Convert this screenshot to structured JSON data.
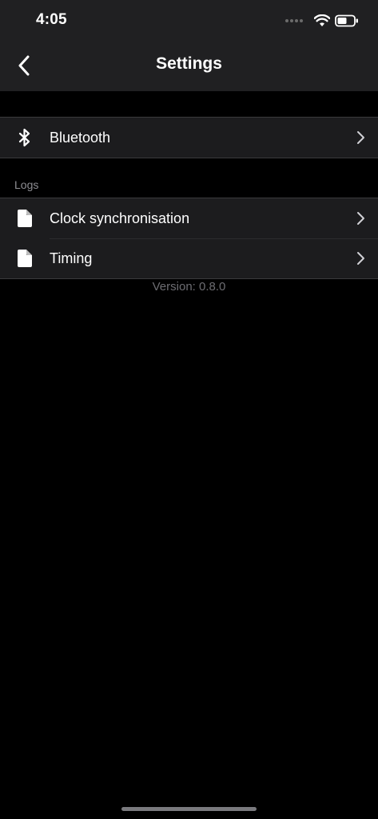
{
  "status_bar": {
    "time": "4:05",
    "icons": [
      "signal-icon",
      "wifi-icon",
      "battery-icon"
    ]
  },
  "nav": {
    "back_icon": "chevron-left-icon",
    "title": "Settings"
  },
  "groups": [
    {
      "header": "",
      "items": [
        {
          "label": "Bluetooth",
          "icon": "bluetooth-icon"
        }
      ]
    },
    {
      "header": "Logs",
      "items": [
        {
          "label": "Clock synchronisation",
          "icon": "document-icon"
        },
        {
          "label": "Timing",
          "icon": "document-icon"
        }
      ]
    }
  ],
  "footer": {
    "version": "Version: 0.8.0"
  },
  "colors": {
    "background": "#000000",
    "header_background": "#202022",
    "row_background": "#1c1c1e",
    "separator": "#3a3a3c",
    "secondary_text": "#8e8e93",
    "version_text": "#6d6d72"
  }
}
